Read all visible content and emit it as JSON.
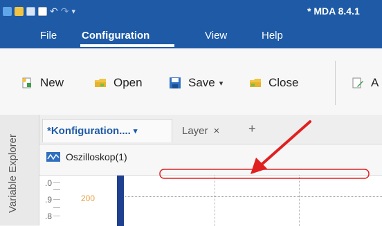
{
  "app": {
    "title": "* MDA 8.4.1"
  },
  "quick_access": {
    "icons": [
      "app-icon",
      "folder-icon",
      "save-icon",
      "document-icon",
      "undo-icon",
      "redo-icon",
      "customize-dropdown-icon"
    ]
  },
  "menu": {
    "items": [
      {
        "label": "File",
        "active": false
      },
      {
        "label": "Configuration",
        "active": true
      },
      {
        "label": "View",
        "active": false
      },
      {
        "label": "Help",
        "active": false
      }
    ]
  },
  "ribbon": {
    "new_label": "New",
    "open_label": "Open",
    "save_label": "Save",
    "close_label": "Close",
    "extra_label": "A"
  },
  "explorer": {
    "label": "Variable Explorer"
  },
  "tabs": [
    {
      "label": "*Konfiguration....",
      "active": true
    },
    {
      "label": "Layer",
      "active": false
    }
  ],
  "tab_add_label": "+",
  "document": {
    "title": "Oszilloskop(1)",
    "plot": {
      "y_labels": [
        ".0",
        ".9",
        ".8"
      ],
      "highlight_value": "200"
    }
  },
  "colors": {
    "titlebar": "#1e5aa6",
    "annotation": "#e02020",
    "signal_strip": "#1f3f8f"
  }
}
